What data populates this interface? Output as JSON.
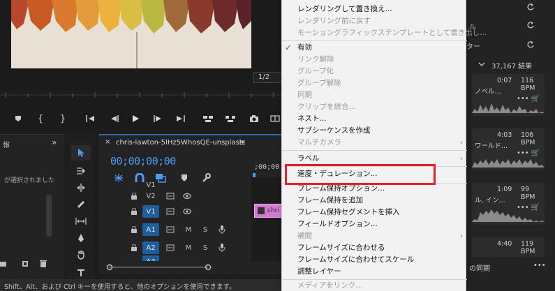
{
  "monitor": {
    "fraction": "1/2",
    "transport_icons": [
      "marker-icon",
      "mark-in-icon",
      "mark-out-icon",
      "go-to-in-icon",
      "step-back-icon",
      "play-icon",
      "step-forward-icon",
      "go-to-out-icon",
      "lift-icon",
      "extract-icon",
      "export-frame-icon",
      "comparison-view-icon"
    ]
  },
  "left_panel": {
    "header_fragment": "報",
    "info_text": "が選択されました"
  },
  "timeline": {
    "close": "×",
    "sequence_name": "chris-lawton-5IHz5WhosQE-unsplash",
    "menu": "≡",
    "timecode": "00;00;00;00",
    "ruler_time": ";00;00",
    "clip_label": "chri",
    "tracks": [
      {
        "name": "V1",
        "type": "video",
        "top_partial": true
      },
      {
        "name": "V2",
        "type": "video"
      },
      {
        "name": "V1",
        "type": "video",
        "on": true
      },
      {
        "name": "A1",
        "type": "audio",
        "on": true
      },
      {
        "name": "A2",
        "type": "audio",
        "on": true
      },
      {
        "name": "A3",
        "type": "audio",
        "on": true,
        "partial": true
      }
    ],
    "m_label": "M",
    "s_label": "S"
  },
  "status_bar": {
    "text": "Shift、Alt、および Ctrl キーを使用すると、他のオプションを使用できます。"
  },
  "right_panel": {
    "top_fragment_1": "ル",
    "top_fragment_2": "ター",
    "result_count": "37,167 結果",
    "cards": [
      {
        "time": "0:07",
        "bpm": "116 BPM",
        "sub": "ノベル..."
      },
      {
        "time": "4:03",
        "bpm": "106 BPM",
        "sub": "ワールド..."
      },
      {
        "time": "1:09",
        "bpm": "99 BPM",
        "sub": "ル, イン..."
      },
      {
        "time": "4:40",
        "bpm": "119 BPM",
        "sub": ""
      }
    ],
    "footer_text": "の同期",
    "more": "•••"
  },
  "context_menu": {
    "items": [
      {
        "label": "レンダリングして置き換え...",
        "enabled": true
      },
      {
        "label": "レンダリング前に戻す",
        "enabled": false
      },
      {
        "label": "モーショングラフィックステンプレートとして書き出し...",
        "enabled": false
      },
      {
        "separator": true
      },
      {
        "label": "有効",
        "enabled": true,
        "checked": true
      },
      {
        "label": "リンク解除",
        "enabled": false
      },
      {
        "label": "グループ化",
        "enabled": false
      },
      {
        "label": "グループ解除",
        "enabled": false
      },
      {
        "label": "同期",
        "enabled": false
      },
      {
        "label": "クリップを統合...",
        "enabled": false
      },
      {
        "label": "ネスト...",
        "enabled": true
      },
      {
        "label": "サブシーケンスを作成",
        "enabled": true
      },
      {
        "label": "マルチカメラ",
        "enabled": false,
        "submenu": true
      },
      {
        "separator": true
      },
      {
        "label": "ラベル",
        "enabled": true,
        "submenu": true
      },
      {
        "separator": true
      },
      {
        "label": "速度・デュレーション...",
        "enabled": true
      },
      {
        "separator": true
      },
      {
        "label": "フレーム保持オプション...",
        "enabled": true
      },
      {
        "label": "フレーム保持を追加",
        "enabled": true
      },
      {
        "label": "フレーム保持セグメントを挿入",
        "enabled": true
      },
      {
        "label": "フィールドオプション...",
        "enabled": true
      },
      {
        "label": "補間",
        "enabled": false,
        "submenu": true
      },
      {
        "label": "フレームサイズに合わせる",
        "enabled": true
      },
      {
        "label": "フレームサイズに合わせてスケール",
        "enabled": true
      },
      {
        "label": "調整レイヤー",
        "enabled": true
      },
      {
        "separator": true
      },
      {
        "label": "メディアをリンク...",
        "enabled": false
      }
    ],
    "submenu_arrow": "›",
    "check": "✓"
  },
  "colors": {
    "accent_blue": "#4a9cf5",
    "highlight_red": "#e8202b",
    "clip_pink": "#d17ad1",
    "menu_bg": "#f2f2f2"
  }
}
